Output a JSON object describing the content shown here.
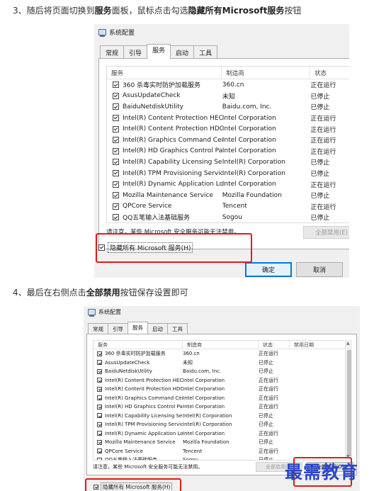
{
  "steps": {
    "step3": {
      "prefix": "3、随后将页面切换到",
      "bold1": "服务",
      "middle": "面板，鼠标点击勾选",
      "bold2": "隐藏所有Microsoft服务",
      "suffix": "按钮"
    },
    "step4": {
      "prefix": "4、最后在右侧点击",
      "bold": "全部禁用",
      "suffix": "按钮保存设置即可"
    }
  },
  "window1": {
    "title": "系统配置",
    "tabs": [
      "常规",
      "引导",
      "服务",
      "启动",
      "工具"
    ],
    "active_tab": 2,
    "columns": [
      "服务",
      "制造商",
      "状态"
    ],
    "rows": [
      {
        "name": "360 杀毒实时防护加载服务",
        "mfr": "360.cn",
        "status": "正在运行"
      },
      {
        "name": "AsusUpdateCheck",
        "mfr": "未知",
        "status": "已停止"
      },
      {
        "name": "BaiduNetdiskUtility",
        "mfr": "Baidu.com, Inc.",
        "status": "已停止"
      },
      {
        "name": "Intel(R) Content Protection HECI ...",
        "mfr": "Intel Corporation",
        "status": "正在运行"
      },
      {
        "name": "Intel(R) Content Protection HDCP...",
        "mfr": "Intel Corporation",
        "status": "正在运行"
      },
      {
        "name": "Intel(R) Graphics Command Cent...",
        "mfr": "Intel Corporation",
        "status": "正在运行"
      },
      {
        "name": "Intel(R) HD Graphics Control Pan...",
        "mfr": "Intel Corporation",
        "status": "正在运行"
      },
      {
        "name": "Intel(R) Capability Licensing Servi...",
        "mfr": "Intel(R) Corporation",
        "status": "已停止"
      },
      {
        "name": "Intel(R) TPM Provisioning Service",
        "mfr": "Intel(R) Corporation",
        "status": "已停止"
      },
      {
        "name": "Intel(R) Dynamic Application Loa...",
        "mfr": "Intel Corporation",
        "status": "正在运行"
      },
      {
        "name": "Mozilla Maintenance Service",
        "mfr": "Mozilla Foundation",
        "status": "已停止"
      },
      {
        "name": "QPCore Service",
        "mfr": "Tencent",
        "status": "正在运行"
      },
      {
        "name": "QQ五笔输入法基础服务",
        "mfr": "Sogou",
        "status": "已停止"
      }
    ],
    "note": "请注意，某些 Microsoft 安全服务可能无法禁用。",
    "disable_all": "全部禁用(E)",
    "hide_ms": "隐藏所有 Microsoft 服务(H)",
    "ok": "确定",
    "cancel": "取消"
  },
  "window2": {
    "title": "系统配置",
    "tabs": [
      "常规",
      "引导",
      "服务",
      "启动",
      "工具"
    ],
    "active_tab": 2,
    "columns": [
      "服务",
      "制造商",
      "状态",
      "禁用日期"
    ],
    "rows": [
      {
        "name": "360 杀毒实时防护加载服务",
        "mfr": "360.cn",
        "status": "正在运行"
      },
      {
        "name": "AsusUpdateCheck",
        "mfr": "未知",
        "status": "已停止"
      },
      {
        "name": "BaiduNetdiskUtility",
        "mfr": "Baidu.com, Inc.",
        "status": "已停止"
      },
      {
        "name": "Intel(R) Content Protection HECI ...",
        "mfr": "Intel Corporation",
        "status": "正在运行"
      },
      {
        "name": "Intel(R) Content Protection HDCP...",
        "mfr": "Intel Corporation",
        "status": "正在运行"
      },
      {
        "name": "Intel(R) Graphics Command Cent...",
        "mfr": "Intel Corporation",
        "status": "正在运行"
      },
      {
        "name": "Intel(R) HD Graphics Control Pan...",
        "mfr": "Intel Corporation",
        "status": "正在运行"
      },
      {
        "name": "Intel(R) Capability Licensing Servi...",
        "mfr": "Intel(R) Corporation",
        "status": "已停止"
      },
      {
        "name": "Intel(R) TPM Provisioning Service",
        "mfr": "Intel(R) Corporation",
        "status": "已停止"
      },
      {
        "name": "Intel(R) Dynamic Application Loa...",
        "mfr": "Intel Corporation",
        "status": "正在运行"
      },
      {
        "name": "Mozilla Maintenance Service",
        "mfr": "Mozilla Foundation",
        "status": "已停止"
      },
      {
        "name": "QPCore Service",
        "mfr": "Tencent",
        "status": "正在运行"
      },
      {
        "name": "QQ五笔输入法基础服务",
        "mfr": "Sogou",
        "status": "已停止"
      }
    ],
    "note": "请注意，某些 Microsoft 安全服务可能无法禁用。",
    "disable_all": "全部启用(E)",
    "enable_all": "全部禁用(D)",
    "hide_ms": "隐藏所有 Microsoft 服务(H)"
  },
  "watermark": "最需教育",
  "colors": {
    "highlight": "#e11b1b",
    "watermark": "#2a46c8",
    "ok_border": "#0078d7"
  }
}
